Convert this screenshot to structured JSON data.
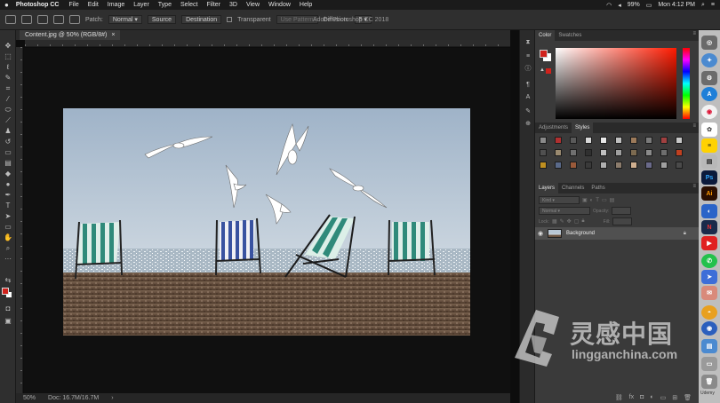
{
  "menubar": {
    "app_name": "Photoshop CC",
    "menus": [
      "File",
      "Edit",
      "Image",
      "Layer",
      "Type",
      "Select",
      "Filter",
      "3D",
      "View",
      "Window",
      "Help"
    ],
    "battery": "99%",
    "clock": "Mon 4:12 PM"
  },
  "options_bar": {
    "patch_label": "Patch:",
    "patch_mode": "Normal",
    "source_label": "Source",
    "destination_label": "Destination",
    "transparent_label": "Transparent",
    "use_pattern_label": "Use Pattern",
    "diffusion_label": "Diffusion:",
    "diffusion_value": "5"
  },
  "window_title": "Adobe Photoshop CC 2018",
  "document": {
    "tab_title": "Content.jpg @ 50% (RGB/8#)",
    "tab_close": "×"
  },
  "status_bar": {
    "zoom": "50%",
    "doc_info": "Doc: 16.7M/16.7M"
  },
  "panels": {
    "color_tabs": [
      "Color",
      "Swatches"
    ],
    "style_tabs": [
      "Adjustments",
      "Styles"
    ],
    "layer_tabs": [
      "Layers",
      "Channels",
      "Paths"
    ],
    "layer_filter": "Kind",
    "blend_mode": "Normal",
    "opacity_label": "Opacity:",
    "lock_label": "Lock:",
    "fill_label": "Fill:",
    "layers": [
      {
        "name": "Background",
        "visible": true,
        "locked": true
      }
    ]
  },
  "colors": {
    "foreground": "#d0221c",
    "background": "#ffffff",
    "style_swatches": [
      "#8a8a8a",
      "#b03030",
      "#5a5a5a",
      "#d9d9d9",
      "#e8e8e8",
      "#c0c0c0",
      "#9c7a5a",
      "#7a7a7a",
      "#a04040",
      "#c8c8c8",
      "#505050",
      "#9a8a70",
      "#707070",
      "#303030",
      "#c0c0c0",
      "#a0a0a0",
      "#7c6a50",
      "#8a8a8a",
      "#6e6e6e",
      "#c04020",
      "#c09020",
      "#5a6a8a",
      "#9a5a3a",
      "#3a3a3a",
      "#b0b0b0",
      "#8c7c6c",
      "#d0b090",
      "#6a6a8a",
      "#a0a0a0",
      "#4a4a4a"
    ]
  },
  "dock": {
    "label": "Udemy",
    "icons": [
      "Ps",
      "Ai"
    ]
  },
  "watermark": {
    "chinese": "灵感中国",
    "english": "lingganchina.com"
  }
}
